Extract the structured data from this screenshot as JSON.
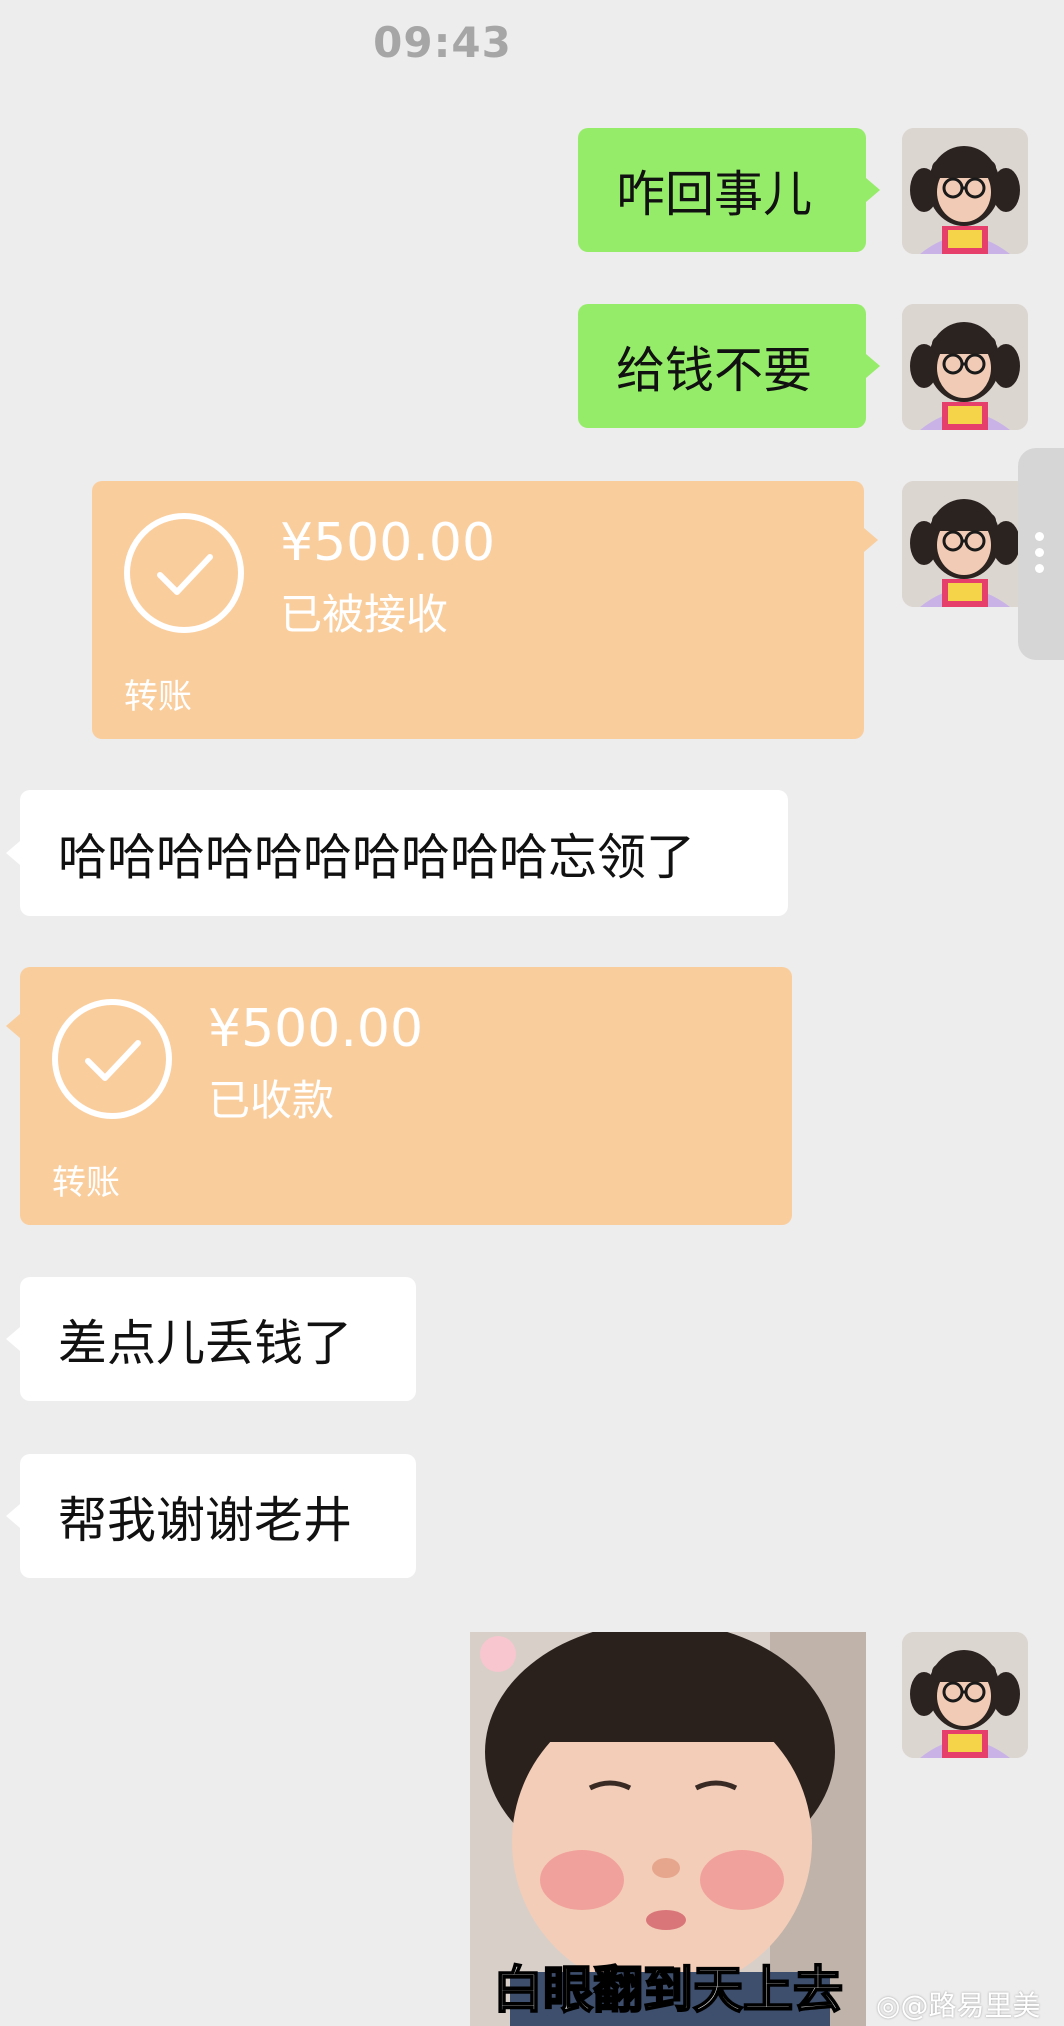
{
  "status_bar": {
    "time": "09:43"
  },
  "messages": [
    {
      "side": "right",
      "type": "text",
      "text": "咋回事儿"
    },
    {
      "side": "right",
      "type": "text",
      "text": "给钱不要"
    },
    {
      "side": "right",
      "type": "transfer",
      "amount": "¥500.00",
      "status": "已被接收",
      "label": "转账"
    },
    {
      "side": "left",
      "type": "text",
      "text": "哈哈哈哈哈哈哈哈哈哈忘领了"
    },
    {
      "side": "left",
      "type": "transfer",
      "amount": "¥500.00",
      "status": "已收款",
      "label": "转账"
    },
    {
      "side": "left",
      "type": "text",
      "text": "差点儿丢钱了"
    },
    {
      "side": "left",
      "type": "text",
      "text": "帮我谢谢老井"
    },
    {
      "side": "right",
      "type": "sticker",
      "caption": "白眼翻到天上去"
    }
  ],
  "watermark": "@路易里美",
  "colors": {
    "background": "#ededed",
    "sent_bubble": "#95ec69",
    "received_bubble": "#ffffff",
    "transfer_bubble": "#facd9d",
    "timestamp": "#a6a6a6"
  },
  "icons": [
    "avatar-image",
    "check-circle-icon",
    "more-dots-icon",
    "weibo-logo"
  ]
}
